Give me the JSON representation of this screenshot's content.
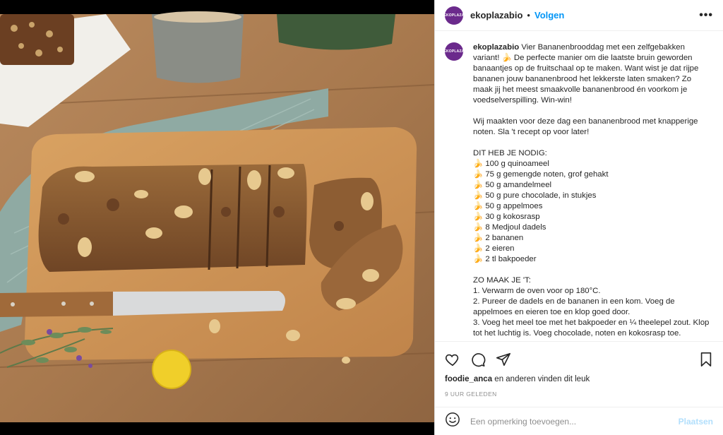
{
  "post": {
    "username": "ekoplazabio",
    "avatar_text": "EKOPLAZA",
    "follow_label": "Volgen",
    "more_label": "•••"
  },
  "caption": {
    "username": "ekoplazabio",
    "text": " Vier Bananenbrooddag met een zelfgebakken variant! 🍌 De perfecte manier om die laatste bruin geworden banaantjes op de fruitschaal op te maken. Want wist je dat rijpe bananen jouw bananenbrood het lekkerste laten smaken? Zo maak jij het meest smaakvolle bananenbrood én voorkom je voedselverspilling. Win-win!\n\nWij maakten voor deze dag een bananenbrood met knapperige noten. Sla 't recept op voor later!\n\nDIT HEB JE NODIG:\n🍌 100 g quinoameel\n🍌 75 g gemengde noten, grof gehakt\n🍌 50 g amandelmeel\n🍌 50 g pure chocolade, in stukjes\n🍌 50 g appelmoes\n🍌 30 g kokosrasp\n🍌 8 Medjoul dadels\n🍌 2 bananen\n🍌 2 eieren\n🍌 2 tl bakpoeder\n\nZO MAAK JE 'T:\n1. Verwarm de oven voor op 180°C.\n2. Pureer de dadels en de bananen in een kom. Voeg de appelmoes en eieren toe en klop goed door.\n3. Voeg het meel toe met het bakpoeder en ¼ theelepel zout. Klop tot het luchtig is. Voeg chocolade, noten en kokosrasp toe."
  },
  "likes": {
    "user": "foodie_anca",
    "rest": " en anderen vinden dit leuk"
  },
  "timestamp": "9 UUR GELEDEN",
  "comment": {
    "placeholder": "Een opmerking toevoegen...",
    "post_label": "Plaatsen"
  },
  "icons": {
    "like": "heart-icon",
    "comment": "comment-icon",
    "share": "paper-plane-icon",
    "save": "bookmark-icon",
    "emoji": "emoji-icon"
  },
  "colors": {
    "link": "#0095f6",
    "post_disabled": "#b2dffc",
    "brand": "#6b2a8c"
  }
}
